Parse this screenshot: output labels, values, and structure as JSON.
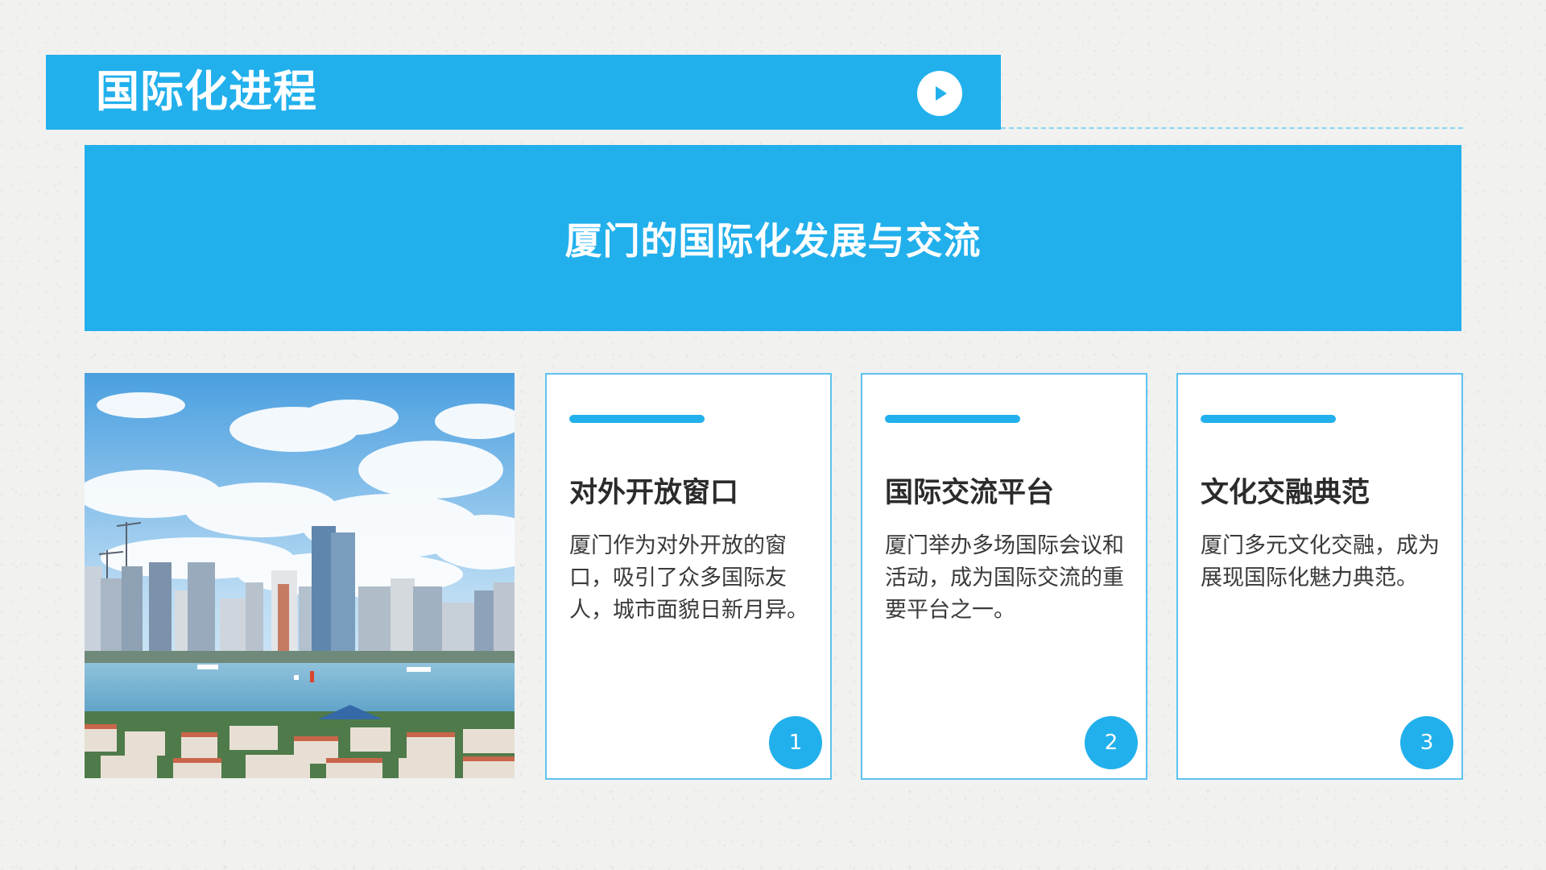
{
  "header": {
    "title": "国际化进程"
  },
  "banner": {
    "title": "厦门的国际化发展与交流"
  },
  "cards": [
    {
      "title": "对外开放窗口",
      "body": "厦门作为对外开放的窗口，吸引了众多国际友人，城市面貌日新月异。",
      "number": "1"
    },
    {
      "title": "国际交流平台",
      "body": "厦门举办多场国际会议和活动，成为国际交流的重要平台之一。",
      "number": "2"
    },
    {
      "title": "文化交融典范",
      "body": "厦门多元文化交融，成为展现国际化魅力典范。",
      "number": "3"
    }
  ],
  "colors": {
    "accent": "#22b0ec",
    "card_border": "#5cc3ef",
    "background": "#f1f1f0"
  },
  "icons": {
    "play": "play-icon"
  }
}
